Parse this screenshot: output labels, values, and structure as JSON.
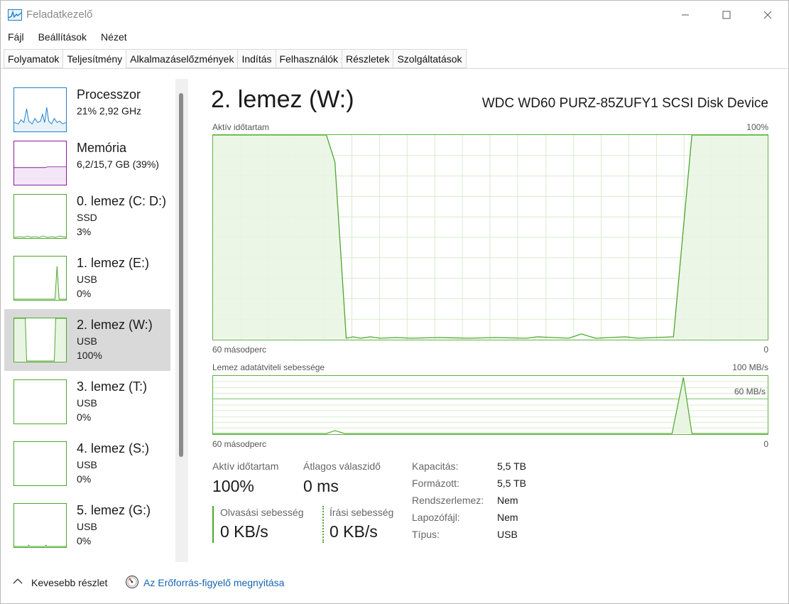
{
  "window": {
    "title": "Feladatkezelő",
    "icon": "task-manager-icon"
  },
  "menu": [
    "Fájl",
    "Beállítások",
    "Nézet"
  ],
  "tabs": [
    {
      "label": "Folyamatok",
      "active": false
    },
    {
      "label": "Teljesítmény",
      "active": true
    },
    {
      "label": "Alkalmazáselőzmények",
      "active": false
    },
    {
      "label": "Indítás",
      "active": false
    },
    {
      "label": "Felhasználók",
      "active": false
    },
    {
      "label": "Részletek",
      "active": false
    },
    {
      "label": "Szolgáltatások",
      "active": false
    }
  ],
  "sidebar": {
    "items": [
      {
        "name": "Processzor",
        "sub1": "21%  2,92 GHz",
        "sub2": "",
        "color": "#1f7fc8",
        "fill": "#e8f2fb"
      },
      {
        "name": "Memória",
        "sub1": "6,2/15,7 GB (39%)",
        "sub2": "",
        "color": "#8b1a9c",
        "fill": "#f3e6f6"
      },
      {
        "name": "0. lemez (C: D:)",
        "sub1": "SSD",
        "sub2": "3%",
        "color": "#4ca72b",
        "fill": "#e9f5e3"
      },
      {
        "name": "1. lemez (E:)",
        "sub1": "USB",
        "sub2": "0%",
        "color": "#4ca72b",
        "fill": "#e9f5e3"
      },
      {
        "name": "2. lemez (W:)",
        "sub1": "USB",
        "sub2": "100%",
        "color": "#4ca72b",
        "fill": "#e9f5e3",
        "selected": true
      },
      {
        "name": "3. lemez (T:)",
        "sub1": "USB",
        "sub2": "0%",
        "color": "#4ca72b",
        "fill": "#e9f5e3"
      },
      {
        "name": "4. lemez (S:)",
        "sub1": "USB",
        "sub2": "0%",
        "color": "#4ca72b",
        "fill": "#e9f5e3"
      },
      {
        "name": "5. lemez (G:)",
        "sub1": "USB",
        "sub2": "0%",
        "color": "#4ca72b",
        "fill": "#e9f5e3"
      }
    ]
  },
  "main": {
    "title": "2. lemez (W:)",
    "device": "WDC WD60 PURZ-85ZUFY1 SCSI Disk Device",
    "graph1": {
      "label": "Aktív időtartam",
      "max": "100%",
      "time": "60 másodperc",
      "min": "0"
    },
    "graph2": {
      "label": "Lemez adatátviteli sebessége",
      "max": "100 MB/s",
      "mid": "60 MB/s",
      "time": "60 másodperc",
      "min": "0"
    },
    "stats": {
      "active_label": "Aktív időtartam",
      "active_value": "100%",
      "response_label": "Átlagos válaszidő",
      "response_value": "0 ms",
      "read_label": "Olvasási sebesség",
      "read_value": "0 KB/s",
      "write_label": "Írási sebesség",
      "write_value": "0 KB/s"
    },
    "info": [
      {
        "label": "Kapacitás:",
        "value": "5,5 TB"
      },
      {
        "label": "Formázott:",
        "value": "5,5 TB"
      },
      {
        "label": "Rendszerlemez:",
        "value": "Nem"
      },
      {
        "label": "Lapozófájl:",
        "value": "Nem"
      },
      {
        "label": "Típus:",
        "value": "USB"
      }
    ]
  },
  "footer": {
    "fewer_details": "Kevesebb részlet",
    "resource_monitor": "Az Erőforrás-figyelő megnyitása"
  },
  "colors": {
    "disk_line": "#4ca72b",
    "disk_fill": "#e9f5e3",
    "grid": "#d7ecce",
    "link": "#1565b5"
  }
}
